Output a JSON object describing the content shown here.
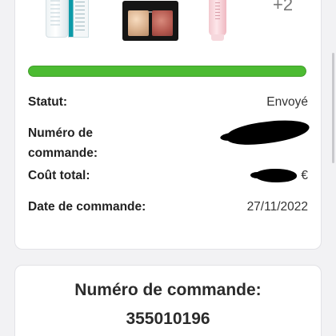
{
  "order": {
    "products": [
      {
        "name": "serum-kit-icon"
      },
      {
        "name": "eyeshadow-duo-icon"
      },
      {
        "name": "pink-tube-icon"
      }
    ],
    "more_count": "+2",
    "progress": 1.0,
    "progress_color": "#4cbb32",
    "status_label": "Statut:",
    "status_value": "Envoyé",
    "number_label": "Numéro de commande:",
    "total_label": "Coût total:",
    "total_currency": "€",
    "date_label": "Date de commande:",
    "date_value": "27/11/2022"
  },
  "order_number_card": {
    "heading": "Numéro de commande:",
    "value": "355010196"
  }
}
